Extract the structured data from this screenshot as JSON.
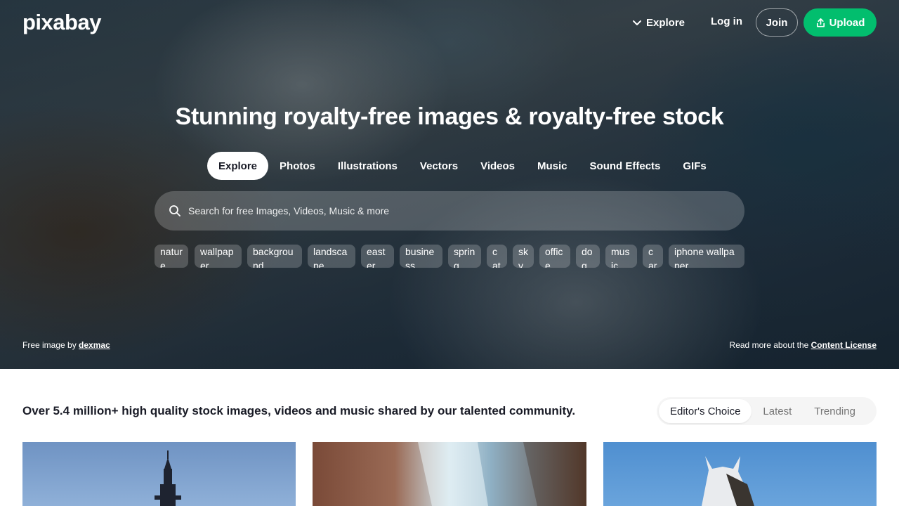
{
  "brand": {
    "logo_text": "pixabay"
  },
  "nav": {
    "explore_label": "Explore",
    "login_label": "Log in",
    "join_label": "Join",
    "upload_label": "Upload"
  },
  "hero": {
    "title": "Stunning royalty-free images & royalty-free stock",
    "tabs": [
      {
        "label": "Explore",
        "active": true
      },
      {
        "label": "Photos"
      },
      {
        "label": "Illustrations"
      },
      {
        "label": "Vectors"
      },
      {
        "label": "Videos"
      },
      {
        "label": "Music"
      },
      {
        "label": "Sound Effects"
      },
      {
        "label": "GIFs"
      }
    ],
    "search_placeholder": "Search for free Images, Videos, Music & more",
    "chips": [
      "nature",
      "wallpaper",
      "background",
      "landscape",
      "easter",
      "business",
      "spring",
      "cat",
      "sky",
      "office",
      "dog",
      "music",
      "car",
      "iphone wallpaper"
    ],
    "credit_prefix": "Free image by",
    "credit_author": "dexmac",
    "license_prefix": "Read more about the",
    "license_link": "Content License"
  },
  "main": {
    "summary": "Over 5.4 million+ high quality stock images, videos and music shared by our talented community.",
    "sort_tabs": [
      {
        "label": "Editor's Choice",
        "active": true
      },
      {
        "label": "Latest"
      },
      {
        "label": "Trending"
      }
    ]
  },
  "colors": {
    "accent": "#02be6e",
    "text": "#191b26",
    "muted": "#767676"
  }
}
